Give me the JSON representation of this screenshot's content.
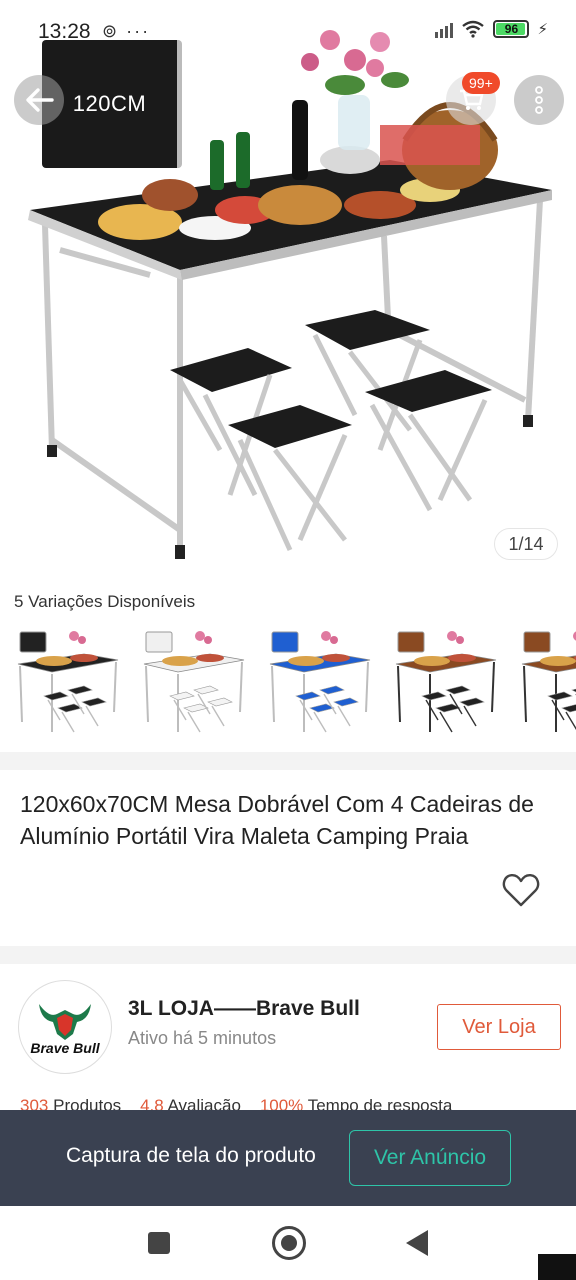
{
  "status_bar": {
    "time": "13:28",
    "left_icons": "⊚ ···",
    "battery_level": "96"
  },
  "hero": {
    "case_label": "120CM",
    "cart_badge": "99+",
    "image_counter": "1/14"
  },
  "variations": {
    "title": "5 Variações Disponíveis",
    "items": [
      {
        "color": "#222222"
      },
      {
        "color": "#f0f0f0"
      },
      {
        "color": "#1f5fd1"
      },
      {
        "color": "#8a4a22"
      },
      {
        "color": "#8a4a22"
      }
    ]
  },
  "product": {
    "title": "120x60x70CM Mesa Dobrável Com 4 Cadeiras de Alumínio Portátil Vira Maleta Camping Praia"
  },
  "store": {
    "logo_text": "Brave Bull",
    "name": "3L LOJA——Brave Bull",
    "active": "Ativo há 5 minutos",
    "visit_label": "Ver Loja",
    "stats": [
      {
        "value": "303",
        "label": "Produtos"
      },
      {
        "value": "4.8",
        "label": "Avaliação"
      },
      {
        "value": "100%",
        "label": "Tempo de resposta"
      }
    ]
  },
  "capture_bar": {
    "text": "Captura de tela do produto",
    "button_label": "Ver Anúncio"
  },
  "colors": {
    "accent": "#e05a3a",
    "teal": "#2ec4a8",
    "dark_bar": "#3a4151"
  }
}
